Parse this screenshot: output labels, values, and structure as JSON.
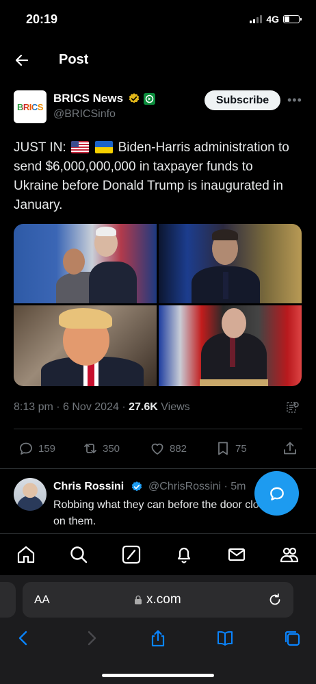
{
  "status": {
    "time": "20:19",
    "network": "4G"
  },
  "header": {
    "title": "Post"
  },
  "author": {
    "avatar_text": "BRICS",
    "name": "BRICS News",
    "handle": "@BRICSinfo",
    "subscribe_label": "Subscribe"
  },
  "tweet": {
    "prefix": "JUST IN:",
    "text": "Biden-Harris administration to send $6,000,000,000 in taxpayer funds to Ukraine before Donald Trump is inaugurated in January."
  },
  "meta": {
    "time": "8:13 pm",
    "date": "6 Nov 2024",
    "views": "27.6K",
    "views_label": "Views"
  },
  "actions": {
    "replies": "159",
    "reposts": "350",
    "likes": "882",
    "bookmarks": "75"
  },
  "reply": {
    "name": "Chris Rossini",
    "handle": "@ChrisRossini · 5m",
    "text": "Robbing what they can before the door closes on them."
  },
  "browser": {
    "aa_label": "AA",
    "url": "x.com"
  },
  "colors": {
    "accent": "#1d9bf0",
    "verified": "#1d9bf0",
    "gold_badge": "#e2b719",
    "muted": "#71767b"
  }
}
